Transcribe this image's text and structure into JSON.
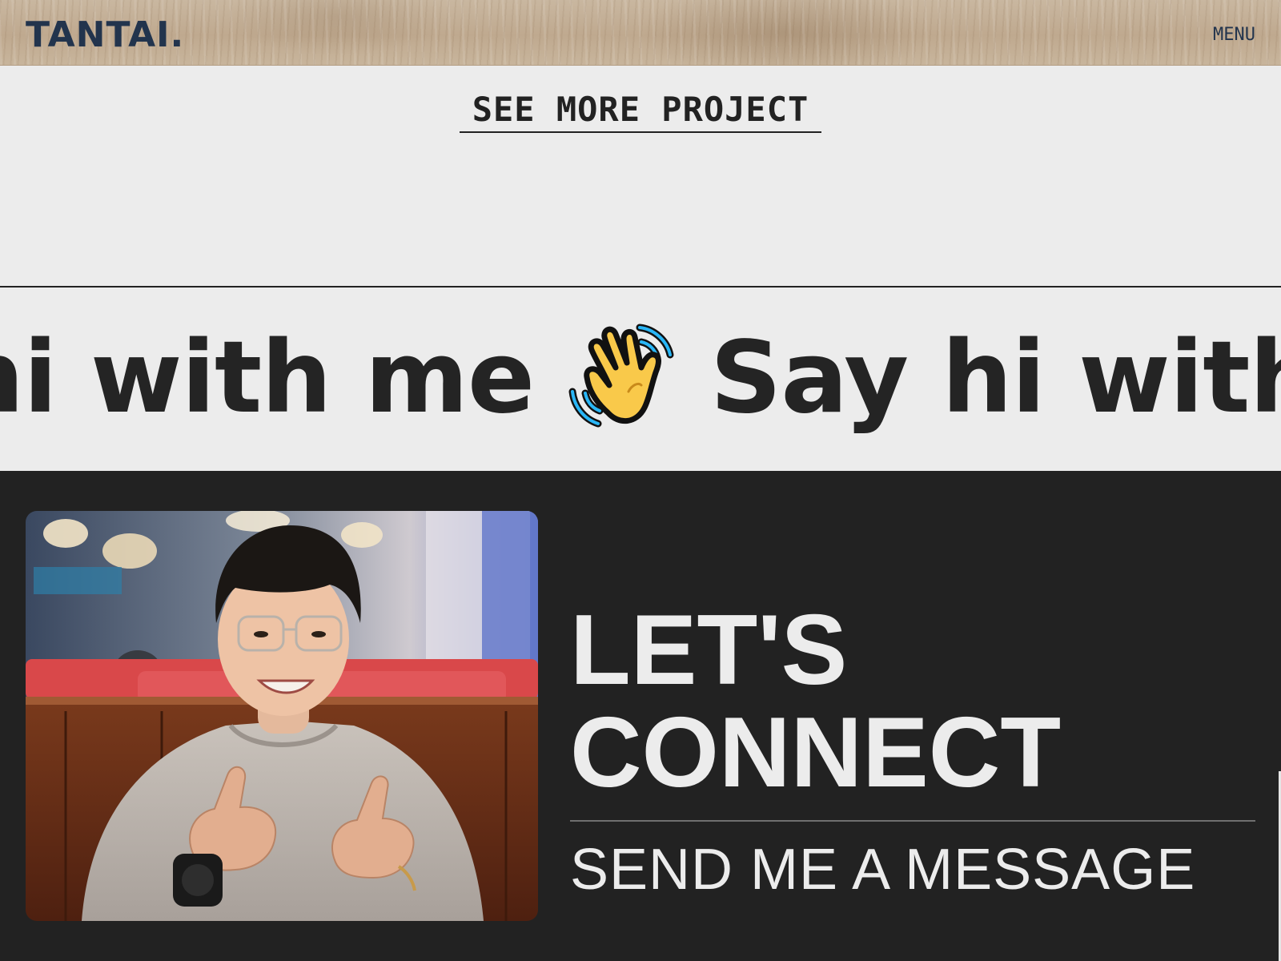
{
  "header": {
    "logo": "TANTAI.",
    "menu_label": "MENU"
  },
  "projects": {
    "see_more_label": "SEE MORE PROJECT"
  },
  "marquee": {
    "text_before": "hi with me",
    "text_after": "Say hi with m",
    "icon": "waving-hand-icon"
  },
  "connect": {
    "title_line1": "LET'S",
    "title_line2": "CONNECT",
    "cta_label": "SEND ME A MESSAGE"
  },
  "colors": {
    "navy": "#22344d",
    "dark": "#222222",
    "light": "#ececec",
    "emoji_yellow": "#f9c94a",
    "emoji_blue": "#29b6f6"
  }
}
